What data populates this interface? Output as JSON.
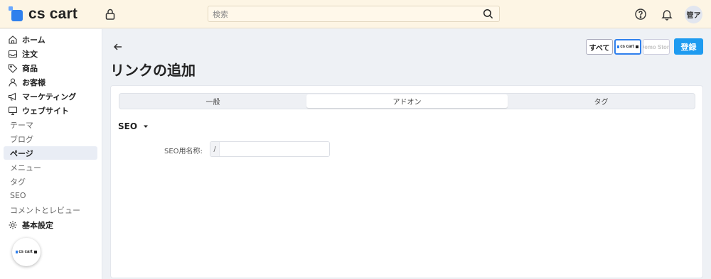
{
  "header": {
    "logo_text": "cs cart",
    "search_placeholder": "検索",
    "avatar_initials": "管ア"
  },
  "sidebar": {
    "items": [
      {
        "label": "ホーム",
        "icon": "home-icon",
        "level": "main"
      },
      {
        "label": "注文",
        "icon": "inbox-icon",
        "level": "main"
      },
      {
        "label": "商品",
        "icon": "tag-icon",
        "level": "main"
      },
      {
        "label": "お客様",
        "icon": "user-icon",
        "level": "main"
      },
      {
        "label": "マーケティング",
        "icon": "megaphone-icon",
        "level": "main"
      },
      {
        "label": "ウェブサイト",
        "icon": "monitor-icon",
        "level": "main"
      },
      {
        "label": "テーマ",
        "level": "sub"
      },
      {
        "label": "ブログ",
        "level": "sub"
      },
      {
        "label": "ページ",
        "level": "sub",
        "active": true
      },
      {
        "label": "メニュー",
        "level": "sub"
      },
      {
        "label": "タグ",
        "level": "sub"
      },
      {
        "label": "SEO",
        "level": "sub"
      },
      {
        "label": "コメントとレビュー",
        "level": "sub"
      },
      {
        "label": "基本設定",
        "icon": "gear-icon",
        "level": "main"
      }
    ],
    "store_badge_text": "cs cart"
  },
  "toolbar": {
    "all_label": "すべて",
    "store_logo_text": "cs cart",
    "demo_store_label": "Demo Store",
    "save_label": "登録"
  },
  "page": {
    "title": "リンクの追加",
    "tabs": [
      {
        "label": "一般",
        "active": false
      },
      {
        "label": "アドオン",
        "active": true
      },
      {
        "label": "タグ",
        "active": false
      }
    ],
    "section_title": "SEO",
    "seo_field": {
      "label": "SEO用名称:",
      "prefix": "/",
      "value": ""
    }
  },
  "colors": {
    "topbar_bg": "#fdf5e4",
    "accent": "#1e9bf0",
    "active_nav_bg": "#e9edf5"
  }
}
